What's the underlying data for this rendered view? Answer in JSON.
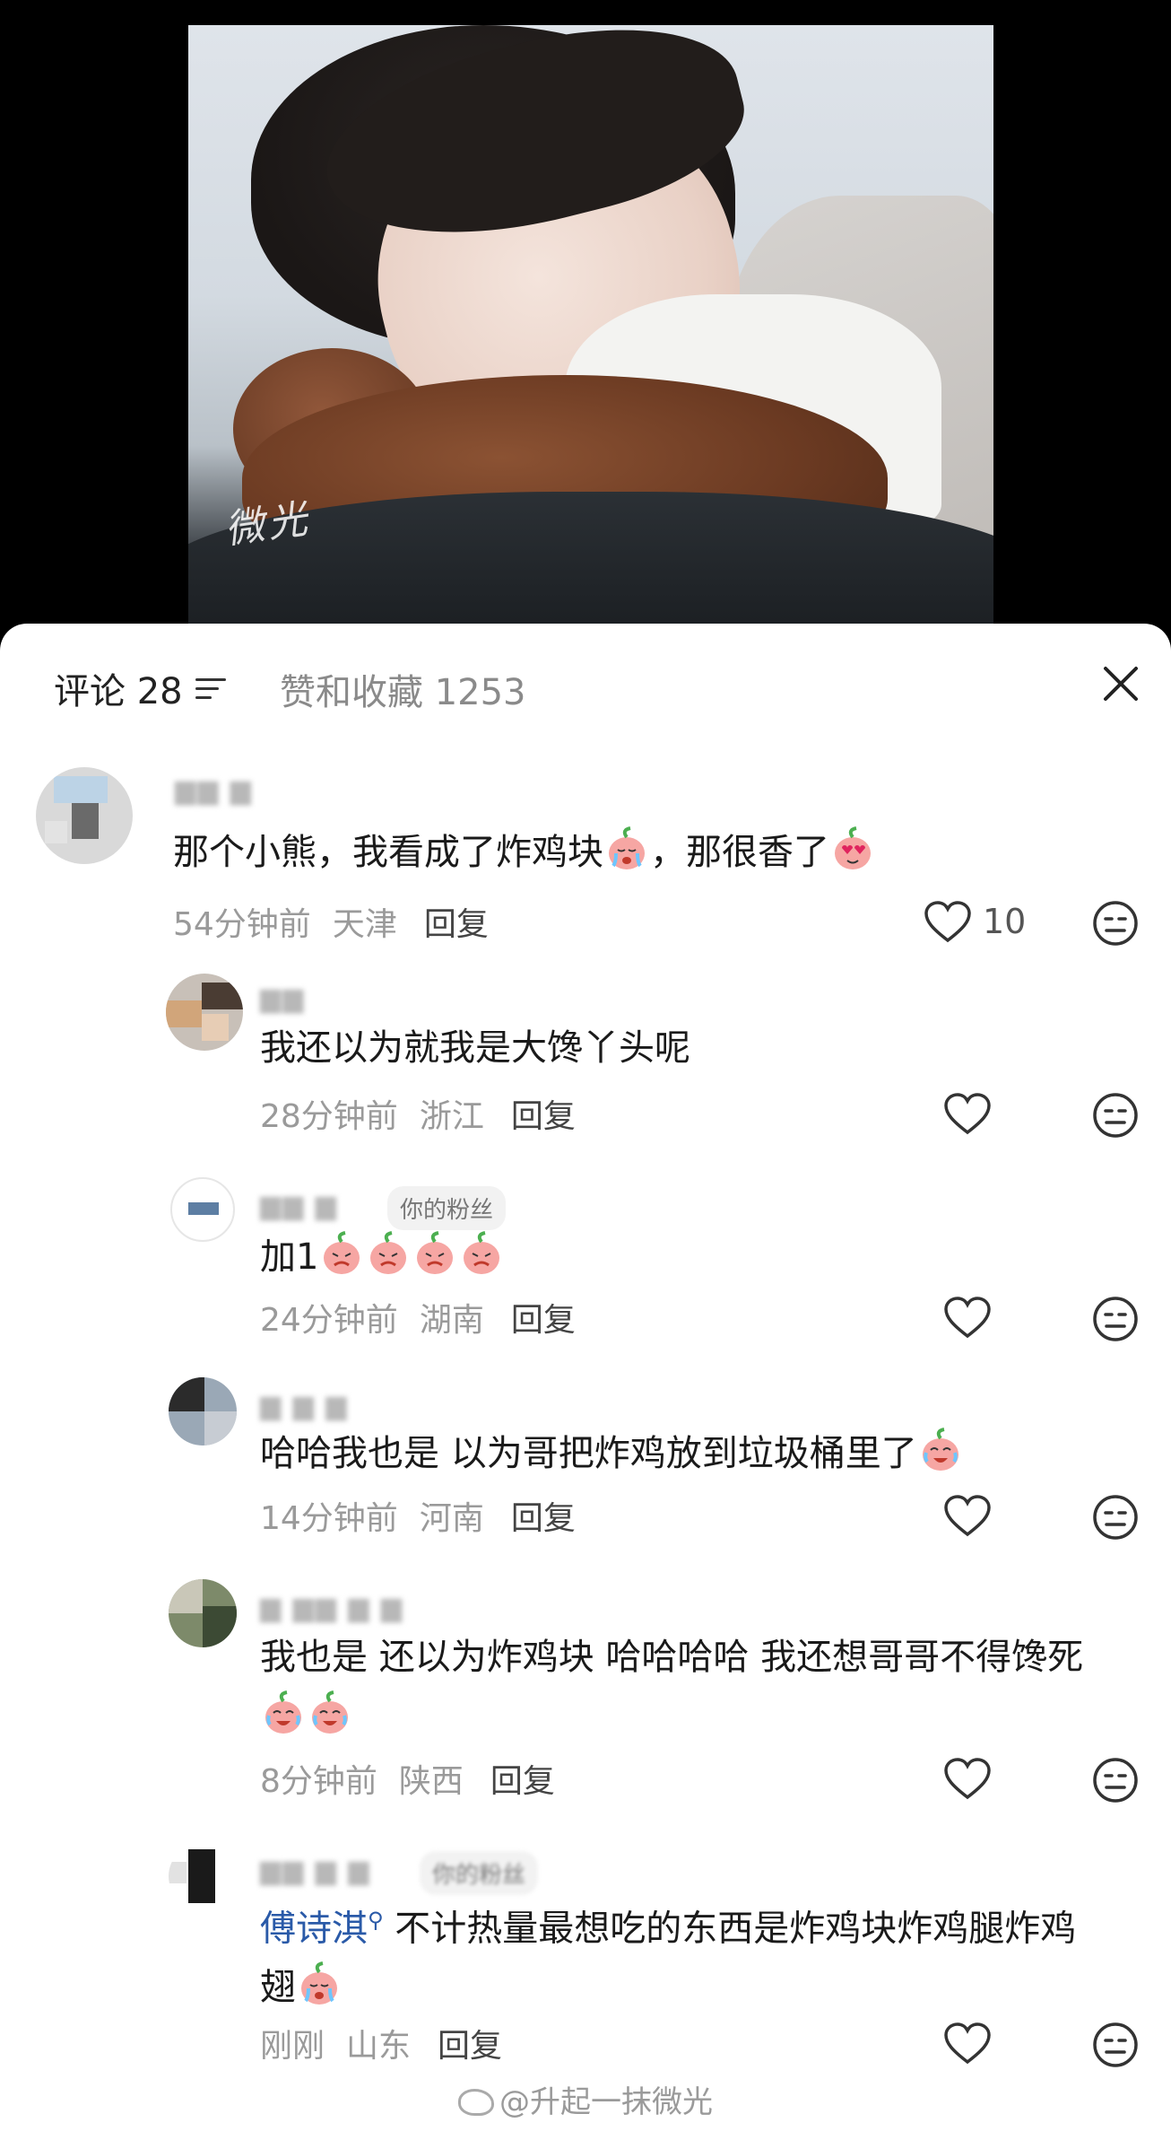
{
  "header": {
    "comments_label": "评论 28",
    "likes_label": "赞和收藏 1253"
  },
  "photo": {
    "watermark": "微光"
  },
  "comments": [
    {
      "name": "",
      "text": "那个小熊，我看成了炸鸡块",
      "text_after": "，那很香了",
      "time": "54分钟前",
      "location": "天津",
      "reply": "回复",
      "likes": "10"
    },
    {
      "name": "",
      "text": "我还以为就我是大馋丫头呢",
      "time": "28分钟前",
      "location": "浙江",
      "reply": "回复"
    },
    {
      "name": "",
      "badge": "你的粉丝",
      "text": "加1",
      "time": "24分钟前",
      "location": "湖南",
      "reply": "回复"
    },
    {
      "name": "",
      "text": "哈哈我也是 以为哥把炸鸡放到垃圾桶里了",
      "time": "14分钟前",
      "location": "河南",
      "reply": "回复"
    },
    {
      "name": "",
      "text": "我也是 还以为炸鸡块 哈哈哈哈 我还想哥哥不得馋死",
      "time": "8分钟前",
      "location": "陕西",
      "reply": "回复"
    },
    {
      "name": "",
      "badge": "你的粉丝",
      "mention": "傅诗淇",
      "text": " 不计热量最想吃的东西是炸鸡块炸鸡腿炸鸡翅",
      "time": "刚刚",
      "location": "山东",
      "reply": "回复"
    }
  ],
  "footer": {
    "watermark": "@升起一抹微光"
  },
  "icons": [
    "sort-icon",
    "close-icon",
    "heart-icon",
    "meh-face-icon",
    "peach-emoji",
    "weibo-icon"
  ]
}
